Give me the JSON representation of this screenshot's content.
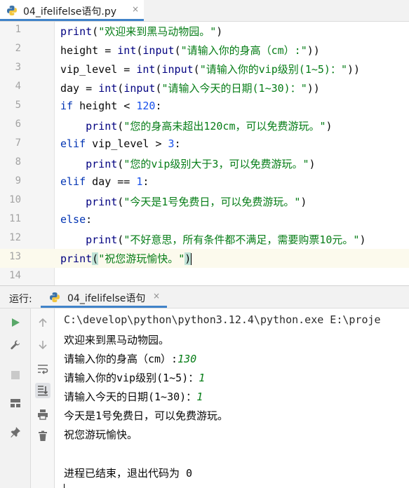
{
  "editor_tab": {
    "title": "04_ifelifelse语句.py",
    "close_glyph": "×"
  },
  "code_lines": [
    {
      "n": "1"
    },
    {
      "n": "2"
    },
    {
      "n": "3"
    },
    {
      "n": "4"
    },
    {
      "n": "5"
    },
    {
      "n": "6"
    },
    {
      "n": "7"
    },
    {
      "n": "8"
    },
    {
      "n": "9"
    },
    {
      "n": "10"
    },
    {
      "n": "11"
    },
    {
      "n": "12"
    },
    {
      "n": "13"
    },
    {
      "n": "14"
    }
  ],
  "code_tokens": {
    "print": "print",
    "input": "input",
    "int": "int",
    "if": "if",
    "elif": "elif",
    "else": "else",
    "l1_str": "\"欢迎来到黑马动物园。\"",
    "l2_var": "height = ",
    "l2_str": "\"请输入你的身高（cm）:\"",
    "l3_var": "vip_level = ",
    "l3_str": "\"请输入你的vip级别(1~5)：\"",
    "l4_var": "day = ",
    "l4_str": "\"请输入今天的日期(1~30)：\"",
    "l5_cond": " height < ",
    "l5_num": "120",
    "l6_str": "\"您的身高未超出120cm，可以免费游玩。\"",
    "l7_cond": " vip_level > ",
    "l7_num": "3",
    "l8_str": "\"您的vip级别大于3，可以免费游玩。\"",
    "l9_cond": " day == ",
    "l9_num": "1",
    "l10_str": "\"今天是1号免费日，可以免费游玩。\"",
    "l12_str": "\"不好意思，所有条件都不满足，需要购票10元。\"",
    "l13_str_a": "\"祝您游玩愉快。\"",
    "open_paren": "(",
    "close_paren": ")",
    "close2": "))",
    "colon": ":"
  },
  "run_panel": {
    "label": "运行:",
    "tab_title": "04_ifelifelse语句",
    "close_glyph": "×"
  },
  "console": {
    "command": "C:\\develop\\python\\python3.12.4\\python.exe E:\\proje",
    "lines": [
      {
        "text": "欢迎来到黑马动物园。",
        "input": ""
      },
      {
        "text": "请输入你的身高（cm）:",
        "input": "130"
      },
      {
        "text": "请输入你的vip级别(1~5)：",
        "input": "1"
      },
      {
        "text": "请输入今天的日期(1~30)：",
        "input": "1"
      },
      {
        "text": "今天是1号免费日，可以免费游玩。",
        "input": ""
      },
      {
        "text": "祝您游玩愉快。",
        "input": ""
      }
    ],
    "exit_message": "进程已结束，退出代码为 0"
  },
  "icons": {
    "python_file": "python-file-icon",
    "run": "run-icon",
    "wrench": "wrench-icon",
    "stop": "stop-icon",
    "layout": "layout-icon",
    "pin": "pin-icon",
    "up": "arrow-up-icon",
    "down": "arrow-down-icon",
    "soft_wrap": "soft-wrap-icon",
    "scroll_to_end": "scroll-to-end-icon",
    "print": "print-icon",
    "trash": "trash-icon"
  },
  "colors": {
    "keyword": "#0033b3",
    "string": "#067d17",
    "number": "#1750eb",
    "run_green": "#59a869",
    "tab_accent": "#4083c9"
  }
}
